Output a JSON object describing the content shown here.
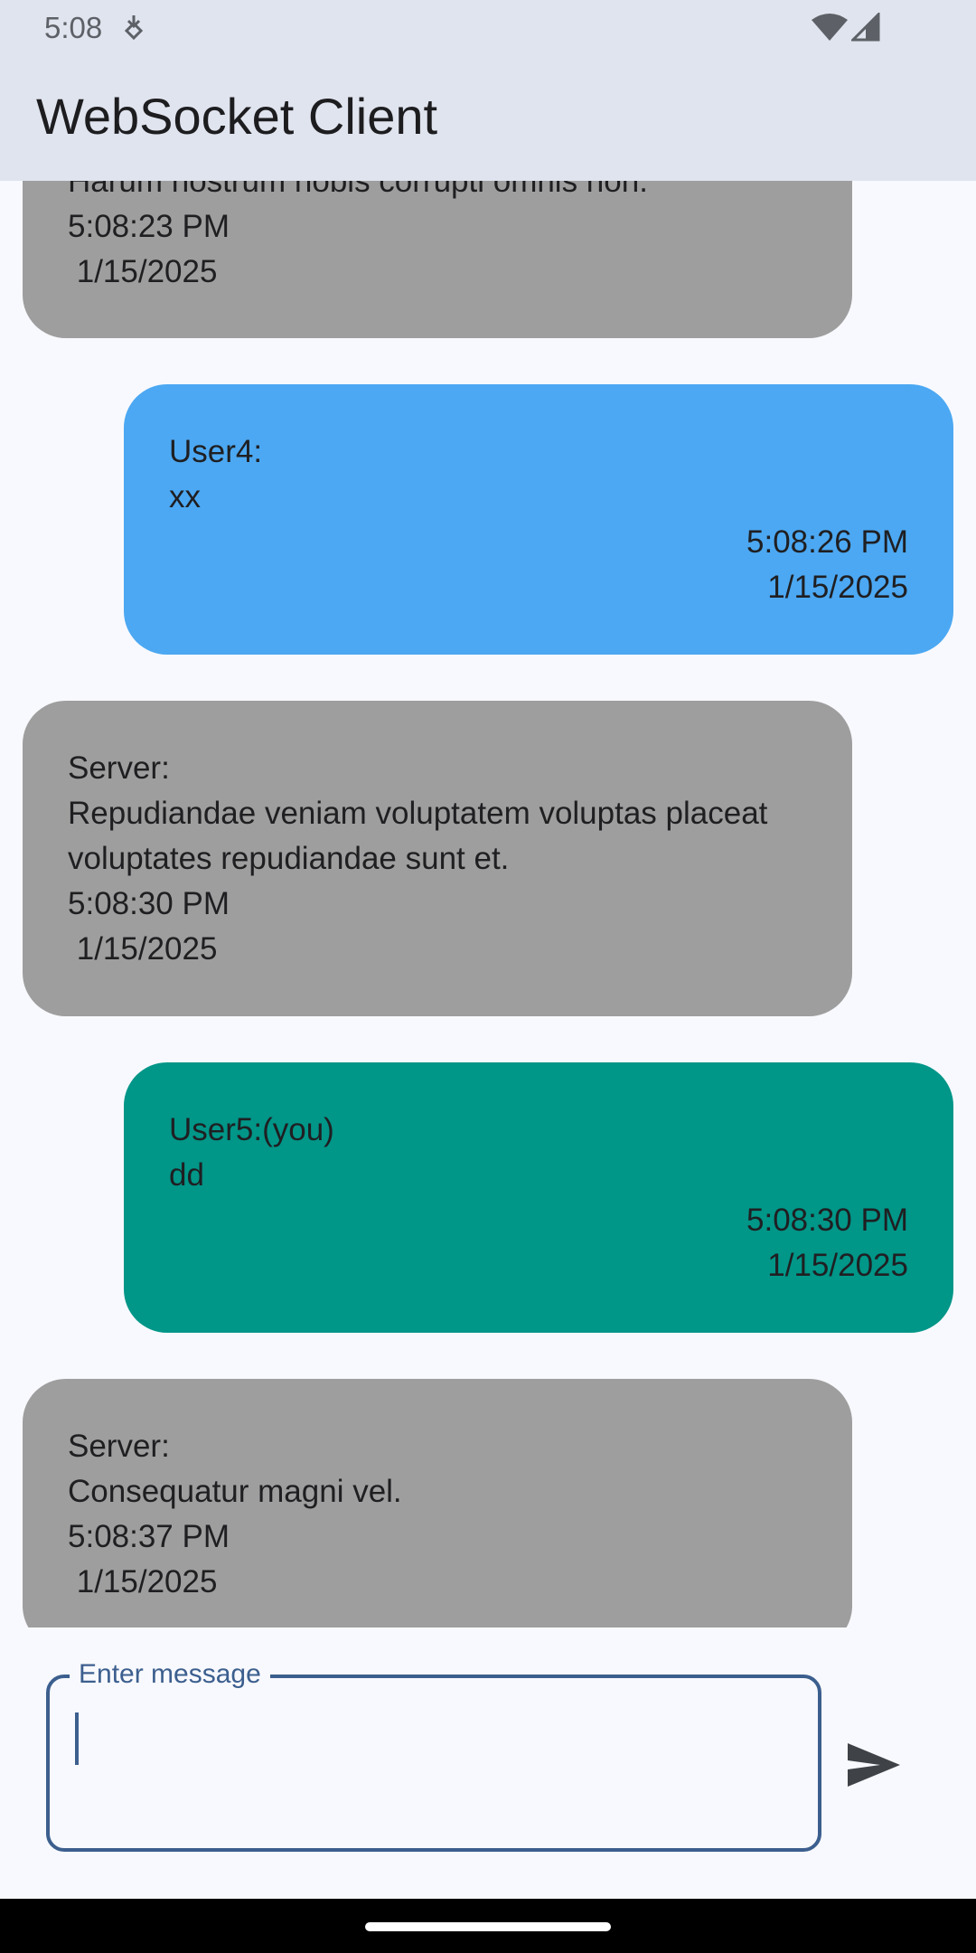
{
  "status_bar": {
    "time": "5:08",
    "icons": [
      "download-indicator-icon",
      "wifi-icon",
      "cellular-signal-icon"
    ]
  },
  "app_bar": {
    "title": "WebSocket Client"
  },
  "colors": {
    "server_bubble": "#9e9e9e",
    "other_user_bubble": "#4ca8f2",
    "own_bubble": "#009688",
    "accent": "#3c5f8e"
  },
  "messages": [
    {
      "side": "left",
      "sender": "",
      "text": "Harum nostrum nobis corrupti omnis non.",
      "time": "5:08:23 PM",
      "date": " 1/15/2025",
      "color": "#9e9e9e"
    },
    {
      "side": "right",
      "sender": "User4:",
      "text": "xx",
      "time": "5:08:26 PM",
      "date": "1/15/2025",
      "color": "#4ca8f2"
    },
    {
      "side": "left",
      "sender": "Server:",
      "text": "Repudiandae veniam voluptatem voluptas placeat voluptates repudiandae sunt et.",
      "time": "5:08:30 PM",
      "date": " 1/15/2025",
      "color": "#9e9e9e"
    },
    {
      "side": "right",
      "sender": "User5:(you)",
      "text": "dd",
      "time": "5:08:30 PM",
      "date": "1/15/2025",
      "color": "#009688"
    },
    {
      "side": "left",
      "sender": "Server:",
      "text": "Consequatur magni vel.",
      "time": "5:08:37 PM",
      "date": " 1/15/2025",
      "color": "#9e9e9e"
    }
  ],
  "composer": {
    "label": "Enter message",
    "value": "",
    "send_icon": "send-icon"
  }
}
